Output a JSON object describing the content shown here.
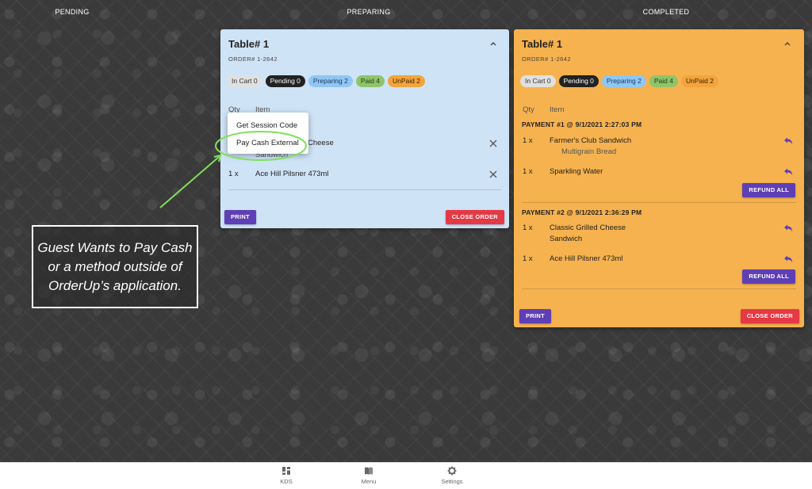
{
  "columns": {
    "pending": "PENDING",
    "preparing": "PREPARING",
    "completed": "COMPLETED"
  },
  "preparing_card": {
    "title": "Table# 1",
    "order": "ORDER# 1-2642",
    "badges": [
      {
        "label": "In Cart 0",
        "color": "#e0e0e0",
        "text_color": "#333333"
      },
      {
        "label": "Pending 0",
        "color": "#222222",
        "text_color": "#ffffff"
      },
      {
        "label": "Preparing 2",
        "color": "#90c6f4",
        "text_color": "#1a3a5a"
      },
      {
        "label": "Paid 4",
        "color": "#8fc46b",
        "text_color": "#1f3a10"
      },
      {
        "label": "UnPaid 2",
        "color": "#f3a43c",
        "text_color": "#3a2200"
      }
    ],
    "qty_header": "Qty",
    "item_header": "Item",
    "items": [
      {
        "qty": "",
        "name": "Cheese",
        "sub": "Sandwich"
      },
      {
        "qty": "1 x",
        "name": "Ace Hill Pilsner 473ml"
      }
    ],
    "print_label": "PRINT",
    "close_label": "CLOSE ORDER"
  },
  "context_menu": {
    "items": [
      "Get Session Code",
      "Pay Cash External"
    ]
  },
  "completed_card": {
    "title": "Table# 1",
    "order": "ORDER# 1-2642",
    "badges": [
      {
        "label": "In Cart 0",
        "color": "#e0e0e0",
        "text_color": "#333333"
      },
      {
        "label": "Pending 0",
        "color": "#222222",
        "text_color": "#ffffff"
      },
      {
        "label": "Preparing 2",
        "color": "#90c6f4",
        "text_color": "#1a3a5a"
      },
      {
        "label": "Paid 4",
        "color": "#8fc46b",
        "text_color": "#1f3a10"
      },
      {
        "label": "UnPaid 2",
        "color": "#f3a43c",
        "text_color": "#3a2200"
      }
    ],
    "qty_header": "Qty",
    "item_header": "Item",
    "payments": [
      {
        "header": "PAYMENT #1 @ 9/1/2021 2:27:03 PM",
        "items": [
          {
            "qty": "1 x",
            "name": "Farmer's Club Sandwich",
            "sub": "Multigrain Bread"
          },
          {
            "qty": "1 x",
            "name": "Sparkling Water"
          }
        ],
        "refund_label": "REFUND ALL"
      },
      {
        "header": "PAYMENT #2 @ 9/1/2021 2:36:29 PM",
        "items": [
          {
            "qty": "1 x",
            "name": "Classic Grilled Cheese",
            "sub": "Sandwich"
          },
          {
            "qty": "1 x",
            "name": "Ace Hill Pilsner 473ml"
          }
        ],
        "refund_label": "REFUND ALL"
      }
    ],
    "print_label": "PRINT",
    "close_label": "CLOSE ORDER"
  },
  "annotation": "Guest Wants to Pay Cash or a method outside of OrderUp’s application.",
  "nav": [
    {
      "label": "KDS",
      "icon": "grid-icon"
    },
    {
      "label": "Menu",
      "icon": "book-icon"
    },
    {
      "label": "Settings",
      "icon": "gear-icon"
    }
  ],
  "colors": {
    "accent": "#5e3fb5",
    "danger": "#e53945",
    "preparing_card": "#cfe3f7",
    "completed_card": "#f6b24e",
    "highlight": "#7fe05a"
  }
}
